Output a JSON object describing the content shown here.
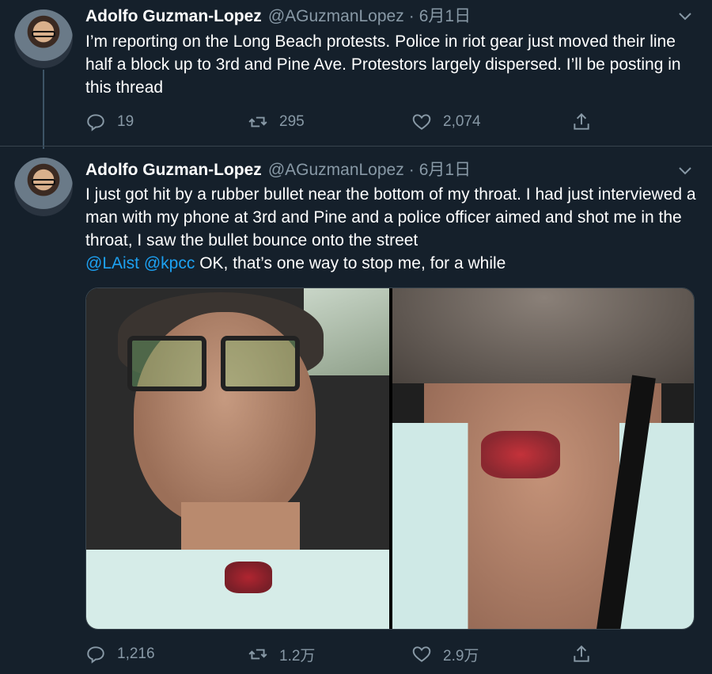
{
  "tweets": [
    {
      "author_name": "Adolfo Guzman-Lopez",
      "handle": "@AGuzmanLopez",
      "separator": "·",
      "date": "6月1日",
      "text": "I’m reporting on the Long Beach protests. Police in riot gear just moved their line half a block up to 3rd and Pine Ave. Protestors largely dispersed. I’ll be posting in this thread",
      "replies": "19",
      "retweets": "295",
      "likes": "2,074"
    },
    {
      "author_name": "Adolfo Guzman-Lopez",
      "handle": "@AGuzmanLopez",
      "separator": "·",
      "date": "6月1日",
      "text_main": "I just got hit by a rubber bullet near the bottom of my throat. I had just interviewed a man with my phone at 3rd and Pine and a police officer aimed and shot me in the throat, I saw the bullet bounce onto the street",
      "mention1": "@LAist",
      "mention2": "@kpcc",
      "text_tail": "OK, that’s one way to stop me, for a while",
      "replies": "1,216",
      "retweets": "1.2万",
      "likes": "2.9万"
    }
  ],
  "colors": {
    "background": "#15202b",
    "secondary_text": "#8899a6",
    "link": "#1da1f2",
    "divider": "#38444d"
  },
  "icons": {
    "reply": "reply-icon",
    "retweet": "retweet-icon",
    "like": "heart-icon",
    "share": "share-icon",
    "more": "chevron-down-icon"
  }
}
